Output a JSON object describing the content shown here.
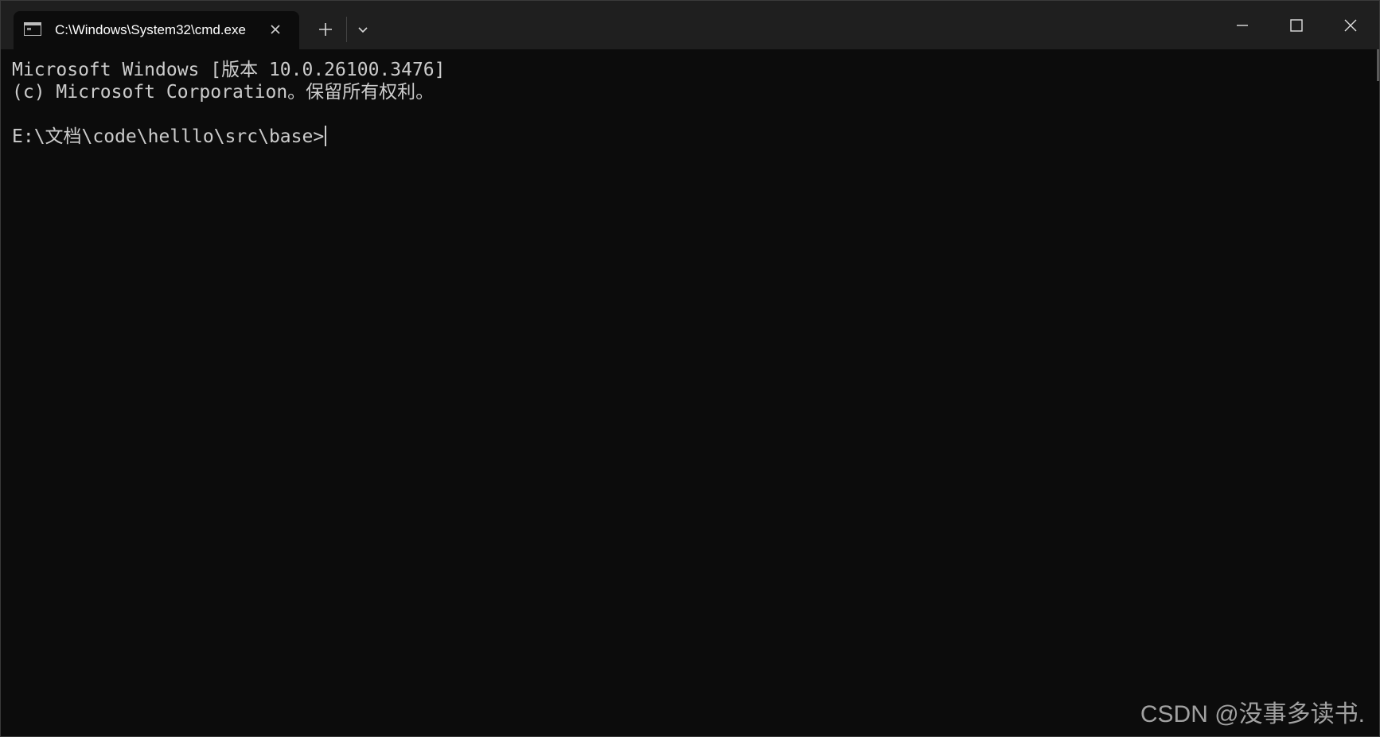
{
  "window": {
    "tab_title": "C:\\Windows\\System32\\cmd.exe",
    "tab_icon": "cmd-terminal-icon",
    "close_tab_glyph": "✕",
    "new_tab_glyph": "+",
    "dropdown_icon": "chevron-down-icon",
    "minimize_icon": "minimize-icon",
    "maximize_icon": "maximize-icon",
    "close_icon": "close-icon"
  },
  "terminal": {
    "lines": [
      "Microsoft Windows [版本 10.0.26100.3476]",
      "(c) Microsoft Corporation。保留所有权利。",
      "",
      "E:\\文档\\code\\helllo\\src\\base>"
    ]
  },
  "watermark": "CSDN @没事多读书.",
  "colors": {
    "background": "#0c0c0c",
    "titlebar": "#1f1f1f",
    "text": "#cccccc"
  }
}
